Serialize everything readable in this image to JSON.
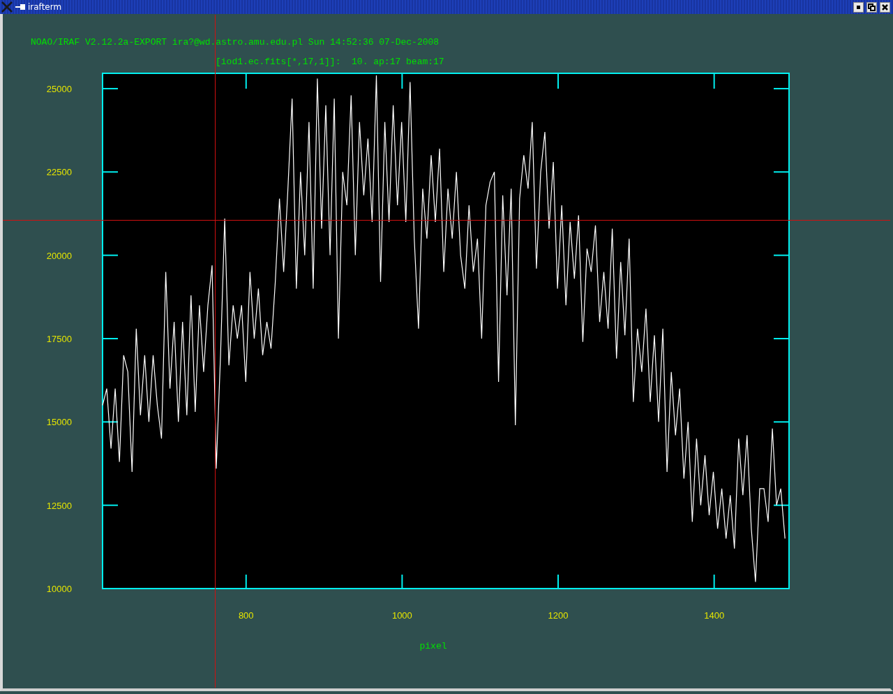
{
  "window": {
    "title": "irafterm"
  },
  "plot": {
    "header": "NOAO/IRAF V2.12.2a-EXPORT ira?@wd.astro.amu.edu.pl Sun 14:52:36 07-Dec-2008",
    "chart_data": {
      "type": "line",
      "title": "[iod1.ec.fits[*,17,1]]:  10. ap:17 beam:17",
      "xlabel": "pixel",
      "xlim": [
        616,
        1496
      ],
      "ylim": [
        10000,
        25460
      ],
      "xticks": [
        800,
        1000,
        1200,
        1400
      ],
      "yticks": [
        10000,
        12500,
        15000,
        17500,
        20000,
        22500,
        25000
      ],
      "x": [
        616,
        621.4,
        626.8,
        632.2,
        637.6,
        643,
        648.4,
        653.8,
        659.2,
        664.6,
        670,
        675.4,
        680.8,
        686.2,
        691.6,
        697,
        702.4,
        707.8,
        713.2,
        718.6,
        724,
        729.4,
        734.8,
        740.2,
        745.6,
        751,
        756.4,
        761.8,
        767.2,
        772.6,
        778,
        783.4,
        788.8,
        794.2,
        799.6,
        805,
        810.4,
        815.8,
        821.2,
        826.6,
        832,
        837.4,
        842.8,
        848.2,
        853.6,
        859,
        864.4,
        869.8,
        875.2,
        880.6,
        886,
        891.4,
        896.8,
        902.2,
        907.6,
        913,
        918.4,
        923.8,
        929.2,
        934.6,
        940,
        945.4,
        950.8,
        956.2,
        961.6,
        967,
        972.4,
        977.8,
        983.2,
        988.6,
        994,
        999.4,
        1004.8,
        1010.2,
        1015.6,
        1021,
        1026.4,
        1031.8,
        1037.2,
        1042.6,
        1048,
        1053.4,
        1058.8,
        1064.2,
        1069.6,
        1075,
        1080.4,
        1085.8,
        1091.2,
        1096.6,
        1102,
        1107.4,
        1112.8,
        1118.2,
        1123.6,
        1129,
        1134.4,
        1139.8,
        1145.2,
        1150.6,
        1156,
        1161.4,
        1166.8,
        1172.2,
        1177.6,
        1183,
        1188.4,
        1193.8,
        1199.2,
        1204.6,
        1210,
        1215.4,
        1220.8,
        1226.2,
        1231.6,
        1237,
        1242.4,
        1247.8,
        1253.2,
        1258.6,
        1264,
        1269.4,
        1274.8,
        1280.2,
        1285.6,
        1291,
        1296.4,
        1301.8,
        1307.2,
        1312.6,
        1318,
        1323.4,
        1328.8,
        1334.2,
        1339.6,
        1345,
        1350.4,
        1355.8,
        1361.2,
        1366.6,
        1372,
        1377.4,
        1382.8,
        1388.2,
        1393.6,
        1399,
        1404.4,
        1409.8,
        1415.2,
        1420.6,
        1426,
        1431.4,
        1436.8,
        1442.2,
        1447.6,
        1453,
        1458.4,
        1463.8,
        1469.2,
        1474.6,
        1480,
        1485.4,
        1490.8
      ],
      "series": [
        {
          "color": "#ffffff",
          "values": [
            15500,
            16000,
            14200,
            16000,
            13800,
            17000,
            16500,
            13500,
            17800,
            15200,
            17000,
            15000,
            17000,
            15500,
            14500,
            19500,
            16000,
            18000,
            15000,
            18000,
            15200,
            18800,
            15300,
            18500,
            16500,
            18500,
            19700,
            13600,
            17000,
            21100,
            16700,
            18500,
            17500,
            18500,
            16200,
            19500,
            17500,
            19000,
            17000,
            18000,
            17200,
            19200,
            21700,
            19500,
            22000,
            24700,
            19000,
            22500,
            20000,
            24000,
            19000,
            25300,
            20800,
            24500,
            20000,
            24700,
            17500,
            22500,
            21500,
            24800,
            20000,
            24000,
            21800,
            23500,
            21000,
            25400,
            19200,
            24000,
            21000,
            24500,
            21500,
            24000,
            21000,
            25200,
            20500,
            17800,
            22000,
            20500,
            23000,
            21000,
            23200,
            19500,
            22000,
            20500,
            22500,
            20000,
            19000,
            21500,
            19500,
            20500,
            17500,
            21500,
            22200,
            22500,
            16200,
            21800,
            18800,
            22000,
            14900,
            21700,
            23000,
            22000,
            24000,
            19600,
            22500,
            23700,
            20800,
            22800,
            19000,
            21500,
            18500,
            21000,
            19300,
            21200,
            17400,
            20200,
            19500,
            20900,
            18000,
            19500,
            17800,
            20800,
            16900,
            19800,
            17600,
            20500,
            15600,
            17800,
            16500,
            18400,
            15600,
            17600,
            15000,
            17800,
            13500,
            16500,
            14600,
            16000,
            13300,
            15000,
            12000,
            14500,
            12500,
            14000,
            12200,
            13500,
            11800,
            13000,
            11500,
            12800,
            11200,
            14500,
            12800,
            14600,
            11800,
            10200,
            13000,
            13000,
            12000,
            14800,
            12500,
            13000,
            11500
          ]
        }
      ],
      "ref_lines": [
        {
          "axis": "x",
          "value": 760
        },
        {
          "axis": "y",
          "value": 21060
        }
      ]
    }
  }
}
